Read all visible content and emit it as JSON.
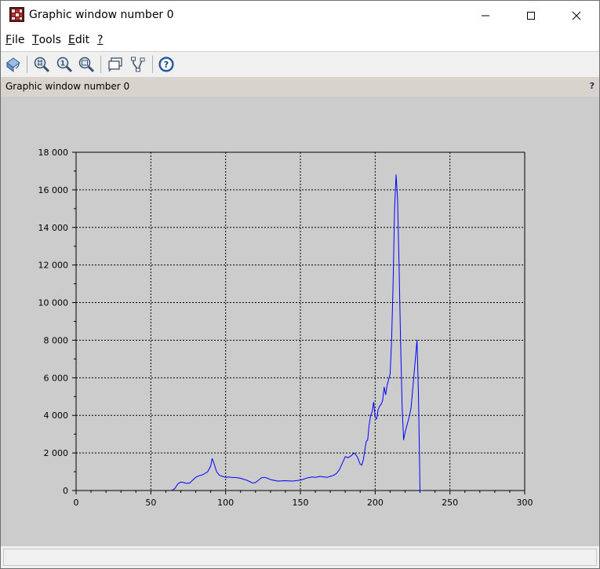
{
  "window": {
    "title": "Graphic window number 0"
  },
  "menu": {
    "items": [
      {
        "mnemonic": "F",
        "rest": "ile"
      },
      {
        "mnemonic": "T",
        "rest": "ools"
      },
      {
        "mnemonic": "E",
        "rest": "dit"
      },
      {
        "mnemonic": "?",
        "rest": ""
      }
    ]
  },
  "toolbar": {
    "icons": [
      "rotate-icon",
      "zoom-in-icon",
      "zoom-original-icon",
      "zoom-region-icon",
      "datatip-icon",
      "edit-axes-icon",
      "help-icon"
    ]
  },
  "infobar": {
    "text": "Graphic window number 0",
    "help": "?"
  },
  "status": {
    "text": ""
  },
  "colors": {
    "canvas_bg": "#cccccc",
    "series": "#0000ff",
    "grid": "#000000"
  },
  "chart_data": {
    "type": "line",
    "title": "",
    "xlabel": "",
    "ylabel": "",
    "xlim": [
      0,
      300
    ],
    "ylim": [
      0,
      18000
    ],
    "x_ticks": [
      "0",
      "50",
      "100",
      "150",
      "200",
      "250",
      "300"
    ],
    "y_ticks": [
      "0",
      "2 000",
      "4 000",
      "6 000",
      "8 000",
      "10 000",
      "12 000",
      "14 000",
      "16 000",
      "18 000"
    ],
    "x_tick_values": [
      0,
      50,
      100,
      150,
      200,
      250,
      300
    ],
    "y_tick_values": [
      0,
      2000,
      4000,
      6000,
      8000,
      10000,
      12000,
      14000,
      16000,
      18000
    ],
    "grid": true,
    "series": [
      {
        "color": "#0000ff",
        "x": [
          64,
          66,
          68,
          70,
          72,
          74,
          76,
          78,
          80,
          82,
          84,
          86,
          88,
          90,
          91,
          92,
          94,
          96,
          98,
          100,
          102,
          104,
          106,
          108,
          110,
          112,
          114,
          116,
          118,
          120,
          122,
          124,
          126,
          128,
          130,
          135,
          140,
          145,
          150,
          152,
          155,
          158,
          160,
          163,
          166,
          168,
          170,
          172,
          174,
          176,
          178,
          180,
          182,
          184,
          186,
          188,
          190,
          191,
          192,
          193,
          194,
          195,
          196,
          197,
          198,
          199,
          200,
          201,
          202,
          203,
          204,
          205,
          206,
          207,
          208,
          209,
          210,
          211,
          212,
          213,
          214,
          215,
          216,
          217,
          218,
          219,
          220,
          221,
          222,
          223,
          224,
          225,
          226,
          227,
          228,
          229,
          230,
          231,
          232
        ],
        "y": [
          0,
          100,
          350,
          450,
          420,
          380,
          400,
          550,
          700,
          780,
          820,
          900,
          1000,
          1300,
          1700,
          1500,
          1000,
          800,
          750,
          700,
          720,
          700,
          690,
          680,
          650,
          600,
          550,
          480,
          400,
          420,
          550,
          680,
          700,
          650,
          580,
          500,
          520,
          500,
          550,
          600,
          680,
          720,
          700,
          750,
          720,
          700,
          750,
          800,
          900,
          1100,
          1450,
          1800,
          1750,
          1850,
          2000,
          1800,
          1400,
          1350,
          1600,
          2100,
          2600,
          2700,
          3500,
          4000,
          4200,
          4700,
          3900,
          3800,
          4300,
          4500,
          4600,
          4800,
          5500,
          5100,
          5600,
          5900,
          6200,
          8000,
          11000,
          15000,
          16800,
          15500,
          12000,
          8000,
          4500,
          2700,
          3100,
          3400,
          3700,
          4000,
          4400,
          5300,
          6200,
          7100,
          8000,
          5000,
          0,
          0,
          0
        ]
      }
    ]
  }
}
